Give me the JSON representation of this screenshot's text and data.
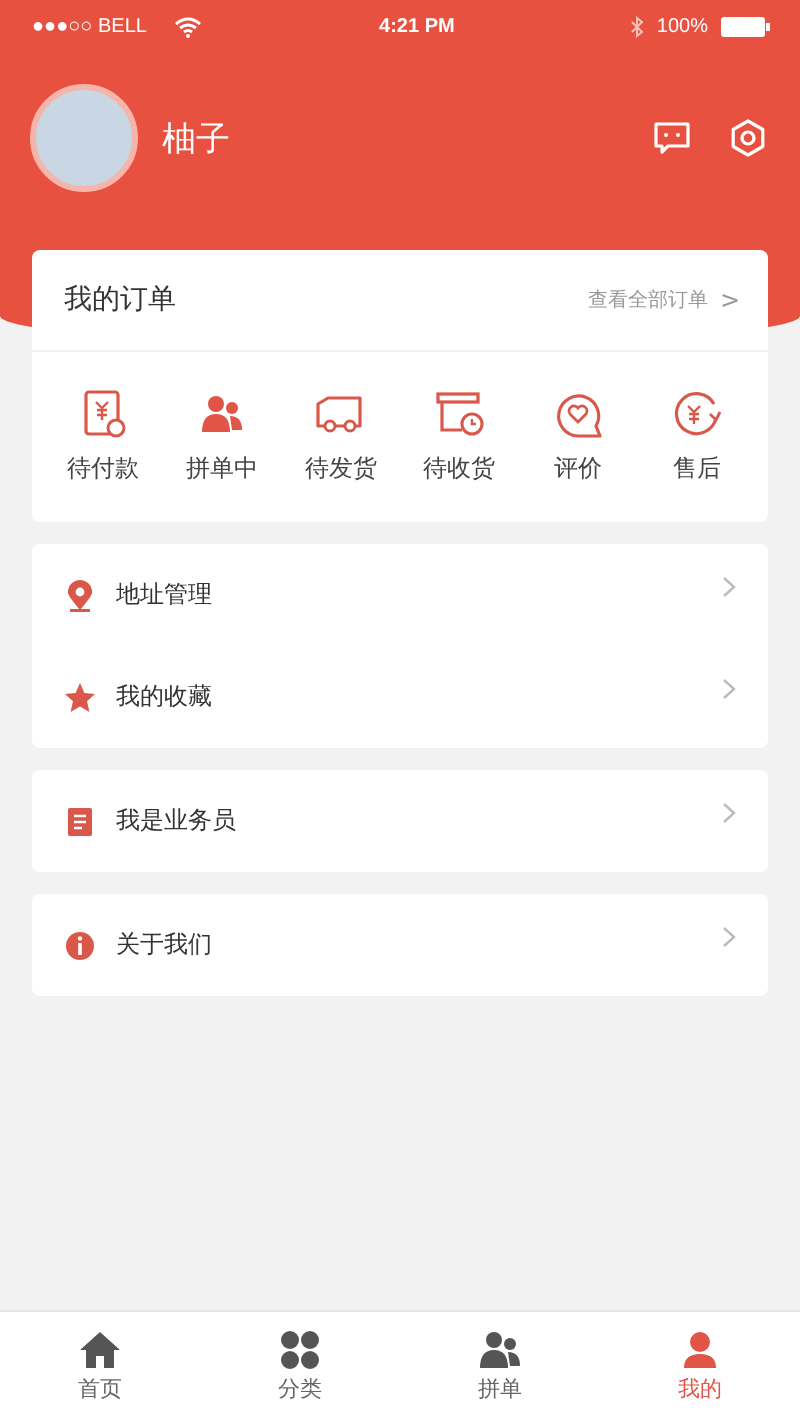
{
  "status_bar": {
    "carrier": "●●●○○ BELL",
    "time": "4:21 PM",
    "battery": "100%"
  },
  "profile": {
    "name": "柚子"
  },
  "orders": {
    "title": "我的订单",
    "view_all": "查看全部订单",
    "chevron": ">",
    "items": [
      {
        "label": "待付款"
      },
      {
        "label": "拼单中"
      },
      {
        "label": "待发货"
      },
      {
        "label": "待收货"
      },
      {
        "label": "评价"
      },
      {
        "label": "售后"
      }
    ]
  },
  "menu_groups": [
    {
      "items": [
        {
          "label": "地址管理"
        },
        {
          "label": "我的收藏"
        }
      ]
    },
    {
      "items": [
        {
          "label": "我是业务员"
        }
      ]
    },
    {
      "items": [
        {
          "label": "关于我们"
        }
      ]
    }
  ],
  "tab_bar": [
    {
      "label": "首页",
      "selected": false
    },
    {
      "label": "分类",
      "selected": false
    },
    {
      "label": "拼单",
      "selected": false
    },
    {
      "label": "我的",
      "selected": true
    }
  ]
}
